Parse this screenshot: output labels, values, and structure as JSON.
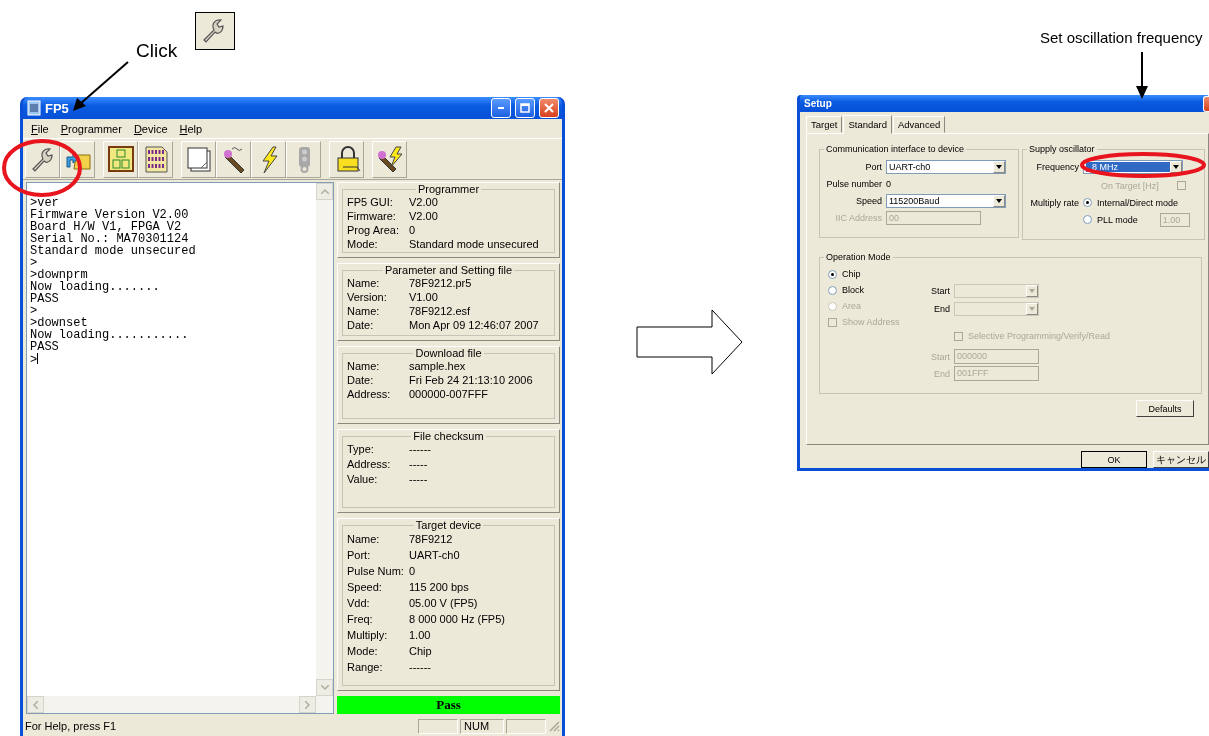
{
  "annotations": {
    "click_label": "Click",
    "callout": "Set oscillation frequency"
  },
  "fp5": {
    "title": "FP5",
    "menu": [
      {
        "label": "File"
      },
      {
        "label": "Programmer"
      },
      {
        "label": "Device"
      },
      {
        "label": "Help"
      }
    ],
    "terminal_lines": [
      ">ver",
      "Firmware Version V2.00",
      "Board H/W V1, FPGA V2",
      "Serial No.: MA70301124",
      "Standard mode unsecured",
      ">",
      ">downprm",
      "Now loading.......",
      "PASS",
      ">",
      ">downset",
      "Now loading...........",
      "PASS",
      ">"
    ],
    "panels": [
      {
        "title": "Programmer",
        "rows": [
          {
            "label": "FP5 GUI:",
            "value": "V2.00"
          },
          {
            "label": "Firmware:",
            "value": "V2.00"
          },
          {
            "label": "Prog Area:",
            "value": "0"
          },
          {
            "label": "Mode:",
            "value": "Standard mode unsecured"
          }
        ]
      },
      {
        "title": "Parameter and Setting file",
        "rows": [
          {
            "label": "Name:",
            "value": "78F9212.pr5"
          },
          {
            "label": "Version:",
            "value": "V1.00"
          },
          {
            "label": "Name:",
            "value": "78F9212.esf"
          },
          {
            "label": "Date:",
            "value": "Mon Apr 09 12:46:07 2007"
          }
        ]
      },
      {
        "title": "Download file",
        "rows": [
          {
            "label": "Name:",
            "value": "sample.hex"
          },
          {
            "label": "Date:",
            "value": "Fri Feb 24 21:13:10 2006"
          },
          {
            "label": "Address:",
            "value": "000000-007FFF"
          }
        ]
      },
      {
        "title": "File checksum",
        "rows": [
          {
            "label": "Type:",
            "value": "------"
          },
          {
            "label": "Address:",
            "value": "-----"
          },
          {
            "label": "Value:",
            "value": "-----"
          }
        ]
      },
      {
        "title": "Target device",
        "rows": [
          {
            "label": "Name:",
            "value": "78F9212"
          },
          {
            "label": "Port:",
            "value": "UART-ch0"
          },
          {
            "label": "Pulse Num:",
            "value": "0"
          },
          {
            "label": "Speed:",
            "value": "115 200 bps"
          },
          {
            "label": "Vdd:",
            "value": "05.00 V (FP5)"
          },
          {
            "label": "Freq:",
            "value": "8 000 000 Hz (FP5)"
          },
          {
            "label": "Multiply:",
            "value": "1.00"
          },
          {
            "label": "Mode:",
            "value": "Chip"
          },
          {
            "label": "Range:",
            "value": "------"
          }
        ]
      }
    ],
    "result": "Pass",
    "status_bar": {
      "text": "For Help, press F1",
      "indicator": "NUM"
    }
  },
  "setup": {
    "title": "Setup",
    "tabs": [
      {
        "label": "Target",
        "selected": false
      },
      {
        "label": "Standard",
        "selected": true
      },
      {
        "label": "Advanced",
        "selected": false
      }
    ],
    "communication": {
      "title": "Communication interface to device",
      "port": {
        "label": "Port",
        "value": "UART-ch0"
      },
      "pulse": {
        "label": "Pulse number",
        "value": "0"
      },
      "speed": {
        "label": "Speed",
        "value": "115200Baud"
      },
      "iic": {
        "label": "IIC Address",
        "value": "00",
        "disabled": true
      }
    },
    "oscillator": {
      "title": "Supply oscillator",
      "frequency": {
        "label": "Frequency",
        "value": "8 MHz",
        "selected": true
      },
      "on_target": {
        "label": "On Target [Hz]",
        "checked": false,
        "disabled": true
      },
      "multiply_label": "Multiply rate",
      "modes": [
        {
          "label": "Internal/Direct mode",
          "selected": true
        },
        {
          "label": "PLL mode",
          "selected": false
        }
      ],
      "pll_rate": {
        "value": "1.00",
        "disabled": true
      }
    },
    "operation": {
      "title": "Operation Mode",
      "modes": [
        {
          "label": "Chip",
          "selected": true,
          "disabled": false
        },
        {
          "label": "Block",
          "selected": false,
          "disabled": false
        },
        {
          "label": "Area",
          "selected": false,
          "disabled": true
        }
      ],
      "show_address": {
        "label": "Show Address",
        "checked": false,
        "disabled": true
      },
      "block_start": {
        "label": "Start",
        "disabled": true
      },
      "block_end": {
        "label": "End",
        "disabled": true
      },
      "selective": {
        "label": "Selective Programming/Verify/Read",
        "checked": false,
        "disabled": true
      },
      "area_start": {
        "label": "Start",
        "value": "000000",
        "disabled": true
      },
      "area_end": {
        "label": "End",
        "value": "001FFF",
        "disabled": true
      }
    },
    "buttons": {
      "defaults": "Defaults",
      "ok": "OK",
      "cancel": "キャンセル"
    }
  }
}
